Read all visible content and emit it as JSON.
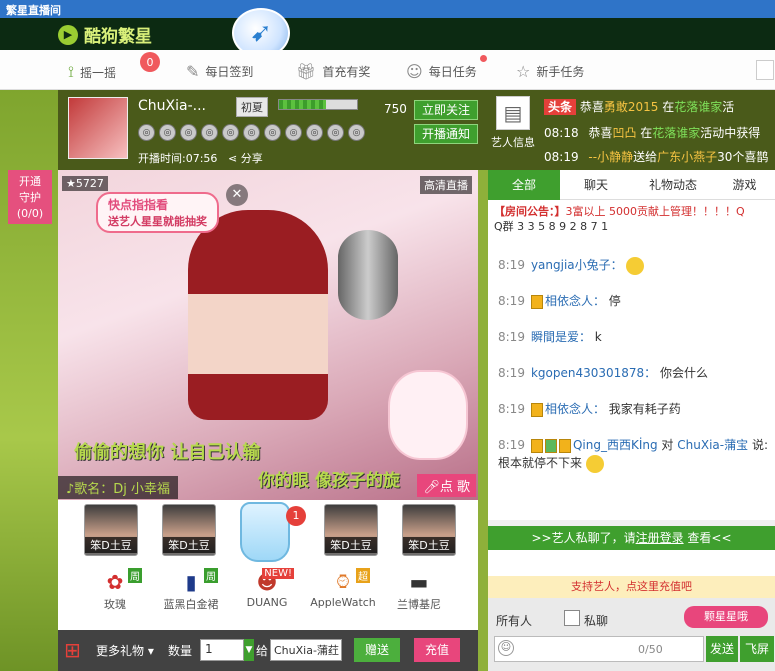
{
  "window": {
    "title": "繁星直播间"
  },
  "brand": {
    "name": "酷狗繁星"
  },
  "tabs": [
    {
      "label": "摇一摇",
      "badge": "0"
    },
    {
      "label": "每日签到"
    },
    {
      "label": "首充有奖"
    },
    {
      "label": "每日任务"
    },
    {
      "label": "新手任务"
    }
  ],
  "guard": {
    "line1": "开通",
    "line2": "守护",
    "count": "(0/0)"
  },
  "anchor": {
    "name": "ChuXia-...",
    "level": "初夏",
    "level_progress": 0.6,
    "fans": "750",
    "live_time": "开播时间:07:56",
    "share": "分享",
    "follow_btn": "立即关注",
    "notify_btn": "开播通知",
    "artist_info": "艺人信息"
  },
  "ticker": [
    {
      "time": "",
      "tag": "头条",
      "text_a": "恭喜",
      "user": "勇敢2015",
      "text_b": " 在",
      "place": "花落谁家",
      "text_c": "活"
    },
    {
      "time": "08:18",
      "text_a": "恭喜",
      "user": "凹凸",
      "text_b": " 在",
      "place": "花落谁家",
      "text_c": "活动中获得"
    },
    {
      "time": "08:19",
      "text_a": "",
      "user": "--小静静",
      "text_b": "送给",
      "place": "广东小燕子",
      "text_c": "30个喜鹊"
    }
  ],
  "video": {
    "viewers": "5727",
    "hd_label": "高清直播",
    "banner_title": "快点指指看",
    "banner_text": "送艺人星星就能抽奖",
    "lyric1": "偷偷的想你  让自己认输",
    "lyric2": "你的眼 像孩子的旋",
    "song": "♪歌名：Dj 小幸福",
    "request_btn": "点 歌"
  },
  "fans_row": [
    {
      "label": "笨D土豆"
    },
    {
      "label": "笨D土豆"
    },
    {
      "label": "笨D土豆"
    },
    {
      "label": "笨D土豆"
    }
  ],
  "jar_badge": "1",
  "gifts": [
    {
      "label": "玫瑰",
      "tag": "周",
      "icon": "rose"
    },
    {
      "label": "蓝黑白金裙",
      "tag": "周",
      "icon": "dress"
    },
    {
      "label": "DUANG",
      "tag": "NEW!",
      "icon": "duang"
    },
    {
      "label": "AppleWatch",
      "tag": "超",
      "icon": "watch"
    },
    {
      "label": "兰博基尼",
      "tag": "",
      "icon": "car"
    }
  ],
  "bottombar": {
    "more_gifts": "更多礼物",
    "qty_label": "数量",
    "qty_value": "1",
    "to_label": "给",
    "target": "ChuXia-蒲荭",
    "send": "赠送",
    "recharge": "充值"
  },
  "chat_tabs": [
    "全部",
    "聊天",
    "礼物动态",
    "游戏"
  ],
  "notice": {
    "title": "【房间公告：】",
    "body": "3富以上 5000贡献上管理！！！！Q",
    "qq": "Q群  3 3 5 8 9 2 8 7 1"
  },
  "messages": [
    {
      "time": "8:19",
      "user": "yangjia小兔子：",
      "text": ""
    },
    {
      "time": "8:19",
      "user": "相依念人：",
      "text": "停"
    },
    {
      "time": "8:19",
      "user": "瞬間是爱：",
      "text": "k"
    },
    {
      "time": "8:19",
      "user": "kgopen430301878：",
      "text": "你会什么"
    },
    {
      "time": "8:19",
      "user": "相依念人：",
      "text": "我家有耗子药"
    },
    {
      "time": "8:19",
      "user": "Qing_西西Kİng",
      "text": "对",
      "to": "ChuXia-蒲宝",
      "say": "说: 根本就停不下来"
    }
  ],
  "pm_bar": {
    "text": ">>艺人私聊了，请",
    "link": "注册登录",
    "tail": "查看<<"
  },
  "support": "支持艺人，点这里充值吧",
  "input": {
    "everyone": "所有人",
    "private": "私聊",
    "star_btn": "颗星星哦",
    "count": "0/50",
    "send": "发送",
    "fly": "飞屏"
  }
}
